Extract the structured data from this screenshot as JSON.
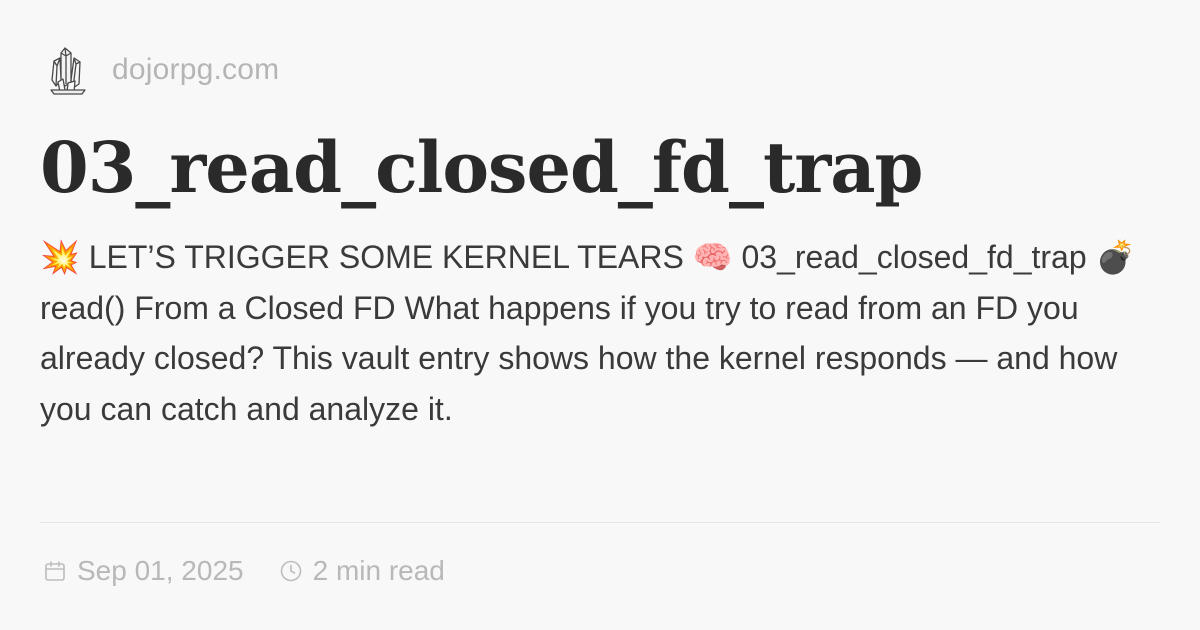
{
  "site": {
    "logo_icon": "crystal-cluster-icon",
    "name": "dojorpg.com"
  },
  "post": {
    "title": "03_read_closed_fd_trap",
    "description": "💥 LET’S TRIGGER SOME KERNEL TEARS 🧠 03_read_closed_fd_trap 💣 read() From a Closed FD What happens if you try to read from an FD you already closed? This vault entry shows how the kernel responds — and how you can catch and analyze it.",
    "date": "Sep 01, 2025",
    "date_icon": "calendar-icon",
    "read_time": "2 min read",
    "read_time_icon": "clock-icon"
  },
  "colors": {
    "background": "#f8f8f8",
    "title": "#2a2a2a",
    "body_text": "#3a3a3a",
    "muted": "#b5b5b5",
    "divider": "#e6e6e6"
  }
}
